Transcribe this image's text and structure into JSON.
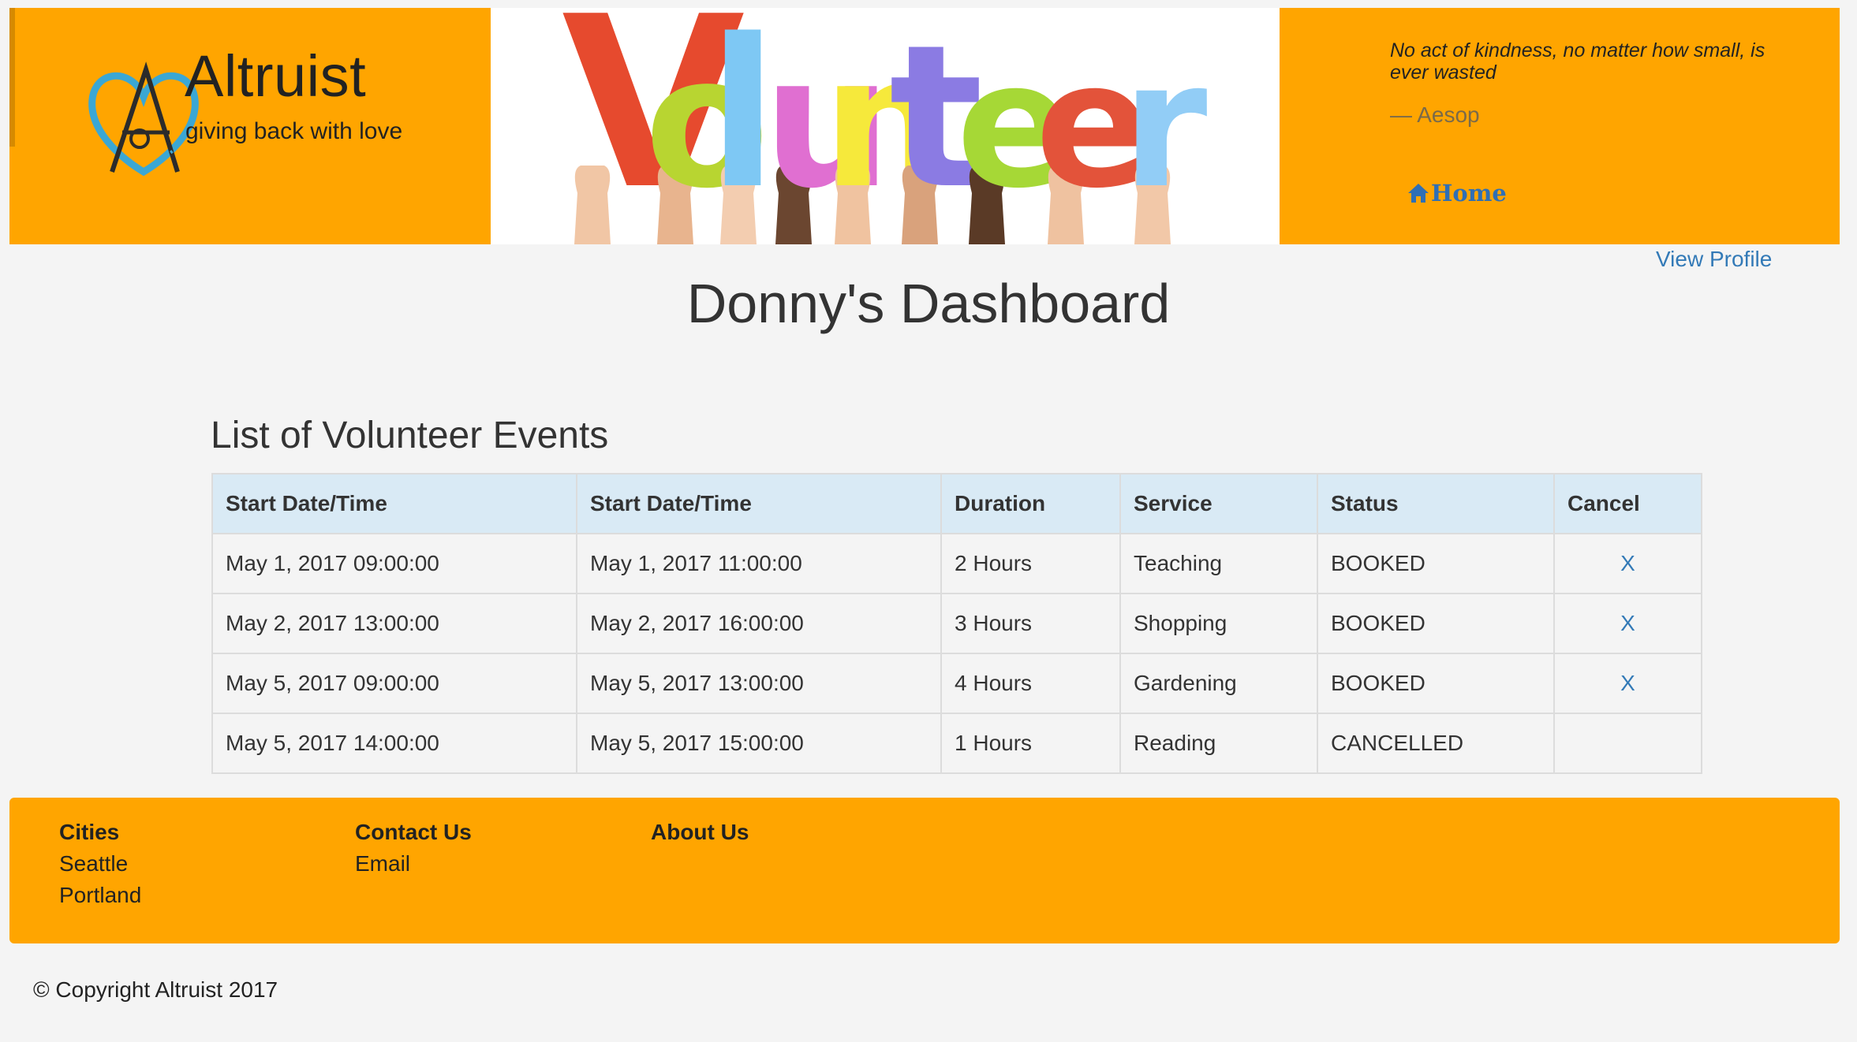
{
  "brand": {
    "name": "Altruist",
    "tagline": "giving back with love"
  },
  "banner": {
    "word": "Volunteer",
    "letter_colors": [
      "#e64a2e",
      "#b8d531",
      "#7ec8f4",
      "#e06fd1",
      "#f6e93b",
      "#8b7be3",
      "#a6d836",
      "#e3533a",
      "#92cdf6"
    ]
  },
  "quote": {
    "text": "No act of kindness, no matter how small, is ever wasted",
    "author": "— Aesop"
  },
  "nav": {
    "home": "Home",
    "view_profile": "View Profile"
  },
  "page": {
    "title": "Donny's Dashboard",
    "section_title": "List of Volunteer Events"
  },
  "table": {
    "headers": [
      "Start Date/Time",
      "Start Date/Time",
      "Duration",
      "Service",
      "Status",
      "Cancel"
    ],
    "rows": [
      {
        "start": "May 1, 2017 09:00:00",
        "end": "May 1, 2017 11:00:00",
        "duration": "2 Hours",
        "service": "Teaching",
        "status": "BOOKED",
        "cancel": "X"
      },
      {
        "start": "May 2, 2017 13:00:00",
        "end": "May 2, 2017 16:00:00",
        "duration": "3 Hours",
        "service": "Shopping",
        "status": "BOOKED",
        "cancel": "X"
      },
      {
        "start": "May 5, 2017 09:00:00",
        "end": "May 5, 2017 13:00:00",
        "duration": "4 Hours",
        "service": "Gardening",
        "status": "BOOKED",
        "cancel": "X"
      },
      {
        "start": "May 5, 2017 14:00:00",
        "end": "May 5, 2017 15:00:00",
        "duration": "1 Hours",
        "service": "Reading",
        "status": "CANCELLED",
        "cancel": ""
      }
    ]
  },
  "footer": {
    "cities": {
      "title": "Cities",
      "items": [
        "Seattle",
        "Portland"
      ]
    },
    "contact": {
      "title": "Contact Us",
      "items": [
        "Email"
      ]
    },
    "about": {
      "title": "About Us"
    },
    "copyright": "© Copyright Altruist 2017"
  },
  "colors": {
    "brand_orange": "#ffa500",
    "link_blue": "#337ab7",
    "table_header": "#d9eaf5"
  },
  "icons": {
    "home": "home-icon",
    "logo": "heart-a-logo-icon"
  }
}
